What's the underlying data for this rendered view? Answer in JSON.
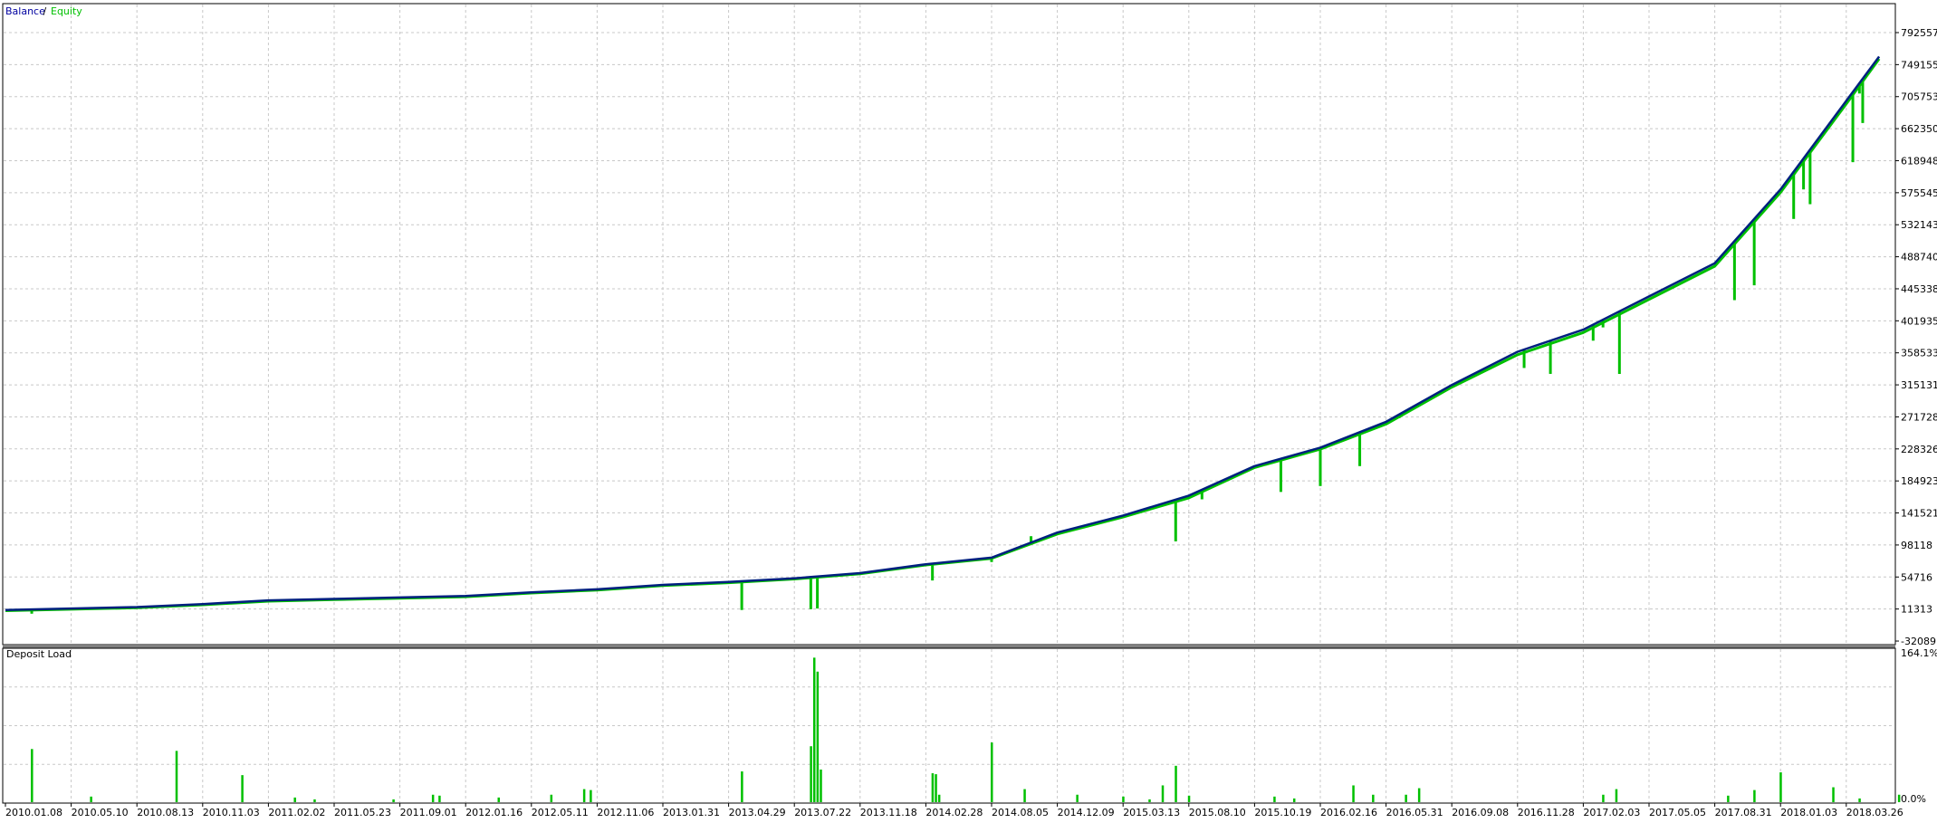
{
  "legend": {
    "balance_label": "Balance",
    "separator": " / ",
    "equity_label": "Equity",
    "balance_color": "#0000a0",
    "equity_color": "#00c000"
  },
  "colors": {
    "balance": "#00207f",
    "equity": "#00c000",
    "deposit_load": "#00c000",
    "grid": "#c8c8c8",
    "axis": "#000000",
    "divider": "#808080"
  },
  "chart_data": [
    {
      "type": "line",
      "panel": "balance-equity",
      "title": "",
      "legend_placement": "top-left",
      "grid": true,
      "y_side": "right",
      "ylim": [
        -12089,
        814000
      ],
      "y_ticks": [
        "792557",
        "749155",
        "705753",
        "662350",
        "618948",
        "575545",
        "532143",
        "488740",
        "445338",
        "401935",
        "358533",
        "315131",
        "271728",
        "228326",
        "184923",
        "141521",
        "98118",
        "54716",
        "11313",
        "-32089"
      ],
      "x_ticks": [
        "2010.01.08",
        "2010.05.10",
        "2010.08.13",
        "2010.11.03",
        "2011.02.02",
        "2011.05.23",
        "2011.09.01",
        "2012.01.16",
        "2012.05.11",
        "2012.11.06",
        "2013.01.31",
        "2013.04.29",
        "2013.07.22",
        "2013.11.18",
        "2014.02.28",
        "2014.08.05",
        "2014.12.09",
        "2015.03.13",
        "2015.08.10",
        "2015.10.19",
        "2016.02.16",
        "2016.05.31",
        "2016.09.08",
        "2016.11.28",
        "2017.02.03",
        "2017.05.05",
        "2017.08.31",
        "2018.01.03",
        "2018.03.26"
      ],
      "series": [
        {
          "name": "Balance",
          "x": [
            0,
            2,
            3,
            4,
            5,
            6,
            7,
            8,
            9,
            10,
            11,
            12,
            13,
            14,
            15,
            16,
            17,
            18,
            19,
            20,
            21,
            22,
            23,
            24,
            25,
            26,
            27,
            28,
            28.5
          ],
          "values": [
            10000,
            14000,
            18000,
            23000,
            25000,
            27000,
            29000,
            34000,
            38000,
            44000,
            48000,
            53000,
            60000,
            72000,
            81000,
            115000,
            138000,
            165000,
            205000,
            230000,
            265000,
            315000,
            360000,
            390000,
            435000,
            480000,
            580000,
            700000,
            760000
          ]
        },
        {
          "name": "Equity",
          "x": [
            0,
            2,
            3,
            4,
            5,
            6,
            7,
            8,
            9,
            10,
            11,
            12,
            13,
            14,
            15,
            16,
            17,
            18,
            19,
            20,
            21,
            22,
            23,
            24,
            25,
            26,
            27,
            28,
            28.5
          ],
          "values": [
            9000,
            13000,
            17000,
            22000,
            24000,
            26000,
            28000,
            33000,
            37000,
            43000,
            47000,
            52000,
            59000,
            71000,
            80000,
            113000,
            136000,
            162000,
            203000,
            228000,
            262000,
            312000,
            356000,
            386000,
            431000,
            476000,
            576000,
            696000,
            757000
          ]
        }
      ],
      "drawdowns": [
        {
          "x": 0.4,
          "value": 5000
        },
        {
          "x": 2.6,
          "value": 14000
        },
        {
          "x": 3.6,
          "value": 19000
        },
        {
          "x": 11.2,
          "value": 10000
        },
        {
          "x": 12.25,
          "value": 11000
        },
        {
          "x": 12.35,
          "value": 12000
        },
        {
          "x": 14.1,
          "value": 50000
        },
        {
          "x": 15.0,
          "value": 75000
        },
        {
          "x": 15.6,
          "value": 110000
        },
        {
          "x": 17.8,
          "value": 103000
        },
        {
          "x": 18.2,
          "value": 160000
        },
        {
          "x": 19.4,
          "value": 170000
        },
        {
          "x": 20.0,
          "value": 178000
        },
        {
          "x": 20.6,
          "value": 205000
        },
        {
          "x": 21.2,
          "value": 270000
        },
        {
          "x": 23.1,
          "value": 338000
        },
        {
          "x": 23.5,
          "value": 330000
        },
        {
          "x": 24.15,
          "value": 375000
        },
        {
          "x": 24.3,
          "value": 393000
        },
        {
          "x": 24.55,
          "value": 330000
        },
        {
          "x": 26.3,
          "value": 430000
        },
        {
          "x": 26.6,
          "value": 450000
        },
        {
          "x": 27.2,
          "value": 540000
        },
        {
          "x": 27.35,
          "value": 580000
        },
        {
          "x": 27.45,
          "value": 560000
        },
        {
          "x": 28.1,
          "value": 617000
        },
        {
          "x": 28.2,
          "value": 710000
        },
        {
          "x": 28.25,
          "value": 670000
        }
      ]
    },
    {
      "type": "bar",
      "panel": "deposit-load",
      "title": "Deposit Load",
      "grid": true,
      "y_side": "right",
      "y_ticks": [
        "164.1%",
        "0.0%"
      ],
      "ylim": [
        0,
        164.1
      ],
      "x": [
        0.4,
        1.3,
        2.6,
        3.6,
        4.4,
        4.7,
        5.9,
        6.5,
        6.6,
        7.5,
        8.3,
        8.8,
        8.9,
        11.2,
        12.2,
        12.25,
        12.3,
        12.35,
        12.4,
        14.1,
        14.15,
        14.2,
        15.0,
        15.5,
        16.3,
        17.0,
        17.4,
        17.6,
        17.8,
        18.0,
        19.3,
        19.6,
        20.5,
        20.8,
        21.3,
        21.5,
        24.3,
        24.5,
        26.2,
        26.6,
        27.0,
        27.8,
        28.2,
        28.8
      ],
      "values": [
        57,
        6,
        55,
        29,
        5,
        3,
        3,
        8,
        7,
        5,
        8,
        14,
        13,
        33,
        0,
        60,
        155,
        140,
        35,
        31,
        30,
        8,
        64,
        14,
        8,
        6,
        3,
        18,
        39,
        7,
        6,
        4,
        18,
        8,
        8,
        15,
        8,
        14,
        7,
        13,
        32,
        16,
        4,
        8
      ]
    }
  ]
}
